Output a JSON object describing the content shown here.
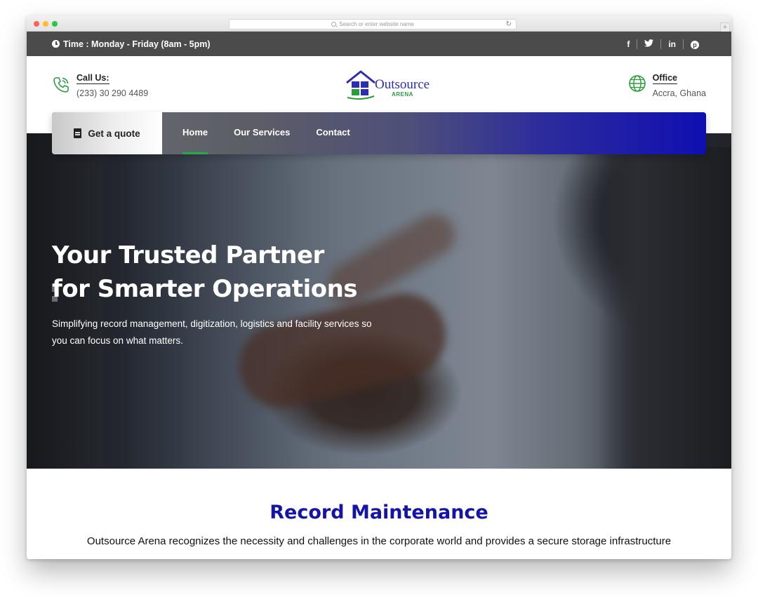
{
  "browser": {
    "url_placeholder": "Search or enter website name",
    "reload_icon": "reload-icon",
    "new_tab_label": "+"
  },
  "topbar": {
    "time": "Time : Monday - Friday (8am - 5pm)",
    "social": {
      "facebook": "f",
      "twitter": "🐦",
      "linkedin": "in",
      "pinterest": "p"
    }
  },
  "header": {
    "call": {
      "title": "Call Us:",
      "value": "(233) 30 290 4489"
    },
    "office": {
      "title": "Office",
      "value": "Accra, Ghana"
    },
    "logo": {
      "line1": "Outsource",
      "line2": "ARENA"
    }
  },
  "nav": {
    "quote_label": "Get a quote",
    "items": [
      {
        "label": "Home",
        "active": true
      },
      {
        "label": "Our Services",
        "active": false
      },
      {
        "label": "Contact",
        "active": false
      }
    ]
  },
  "hero": {
    "title_line1": "Your Trusted Partner",
    "title_line2": "for Smarter Operations",
    "subtitle": "Simplifying record management, digitization, logistics and facility services so you can focus on what matters."
  },
  "section": {
    "title": "Record Maintenance",
    "text": "Outsource Arena recognizes the necessity and challenges in the corporate world and provides a secure storage infrastructure"
  },
  "colors": {
    "topbar": "#4b4b4b",
    "brand_blue": "#1414a6",
    "nav_gradient_end": "#0f0fb1",
    "active_underline": "#2ca84a",
    "icon_green": "#2a9d3b"
  }
}
